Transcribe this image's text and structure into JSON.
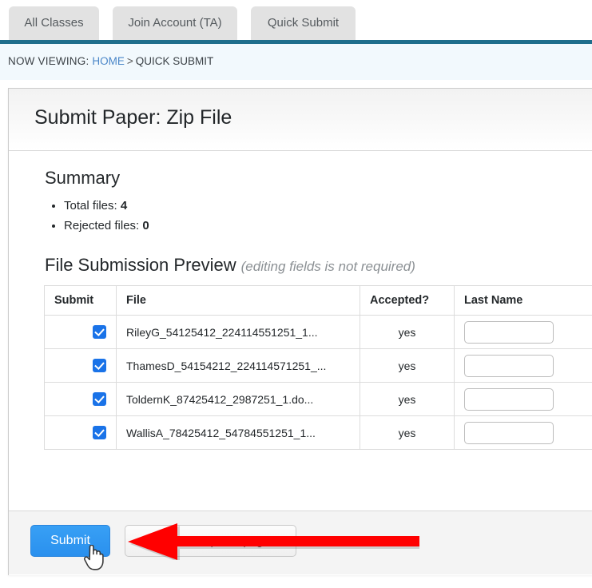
{
  "tabs": [
    {
      "label": "All Classes"
    },
    {
      "label": "Join Account (TA)"
    },
    {
      "label": "Quick Submit"
    }
  ],
  "breadcrumb": {
    "prefix": "NOW VIEWING:",
    "home_label": "HOME",
    "separator": ">",
    "current": "QUICK SUBMIT"
  },
  "panel": {
    "title": "Submit Paper: Zip File"
  },
  "summary": {
    "heading": "Summary",
    "total_label": "Total files:",
    "total_value": "4",
    "rejected_label": "Rejected files:",
    "rejected_value": "0"
  },
  "preview": {
    "heading": "File Submission Preview",
    "note": "(editing fields is not required)",
    "columns": {
      "submit": "Submit",
      "file": "File",
      "accepted": "Accepted?",
      "lastname": "Last Name"
    },
    "rows": [
      {
        "checked": "checkbox-checked",
        "file": "RileyG_54125412_224114551251_1...",
        "accepted": "yes",
        "lastname": "",
        "lastname_placeholder": ""
      },
      {
        "checked": "checkbox-checked",
        "file": "ThamesD_54154212_224114571251_...",
        "accepted": "yes",
        "lastname": "",
        "lastname_placeholder": ""
      },
      {
        "checked": "checkbox-checked",
        "file": "ToldernK_87425412_2987251_1.do...",
        "accepted": "yes",
        "lastname": "",
        "lastname_placeholder": ""
      },
      {
        "checked": "checkbox-checked",
        "file": "WallisA_78425412_54784551251_1...",
        "accepted": "yes",
        "lastname": "",
        "lastname_placeholder": ""
      }
    ]
  },
  "footer": {
    "submit_label": "Submit",
    "return_label": "Return to upload page"
  },
  "annotation": {
    "arrow": "left-pointing-arrow",
    "arrow_color": "#ff0000"
  },
  "cursor": {
    "kind": "pointing-hand-cursor"
  },
  "colors": {
    "accent_teal": "#1f6e8c",
    "link_blue": "#4a86c8",
    "checkbox_blue": "#1a73e8",
    "submit_blue": "#2a90ee",
    "tab_grey": "#e2e2e2",
    "breadcrumb_bg": "#f2f9fd"
  }
}
